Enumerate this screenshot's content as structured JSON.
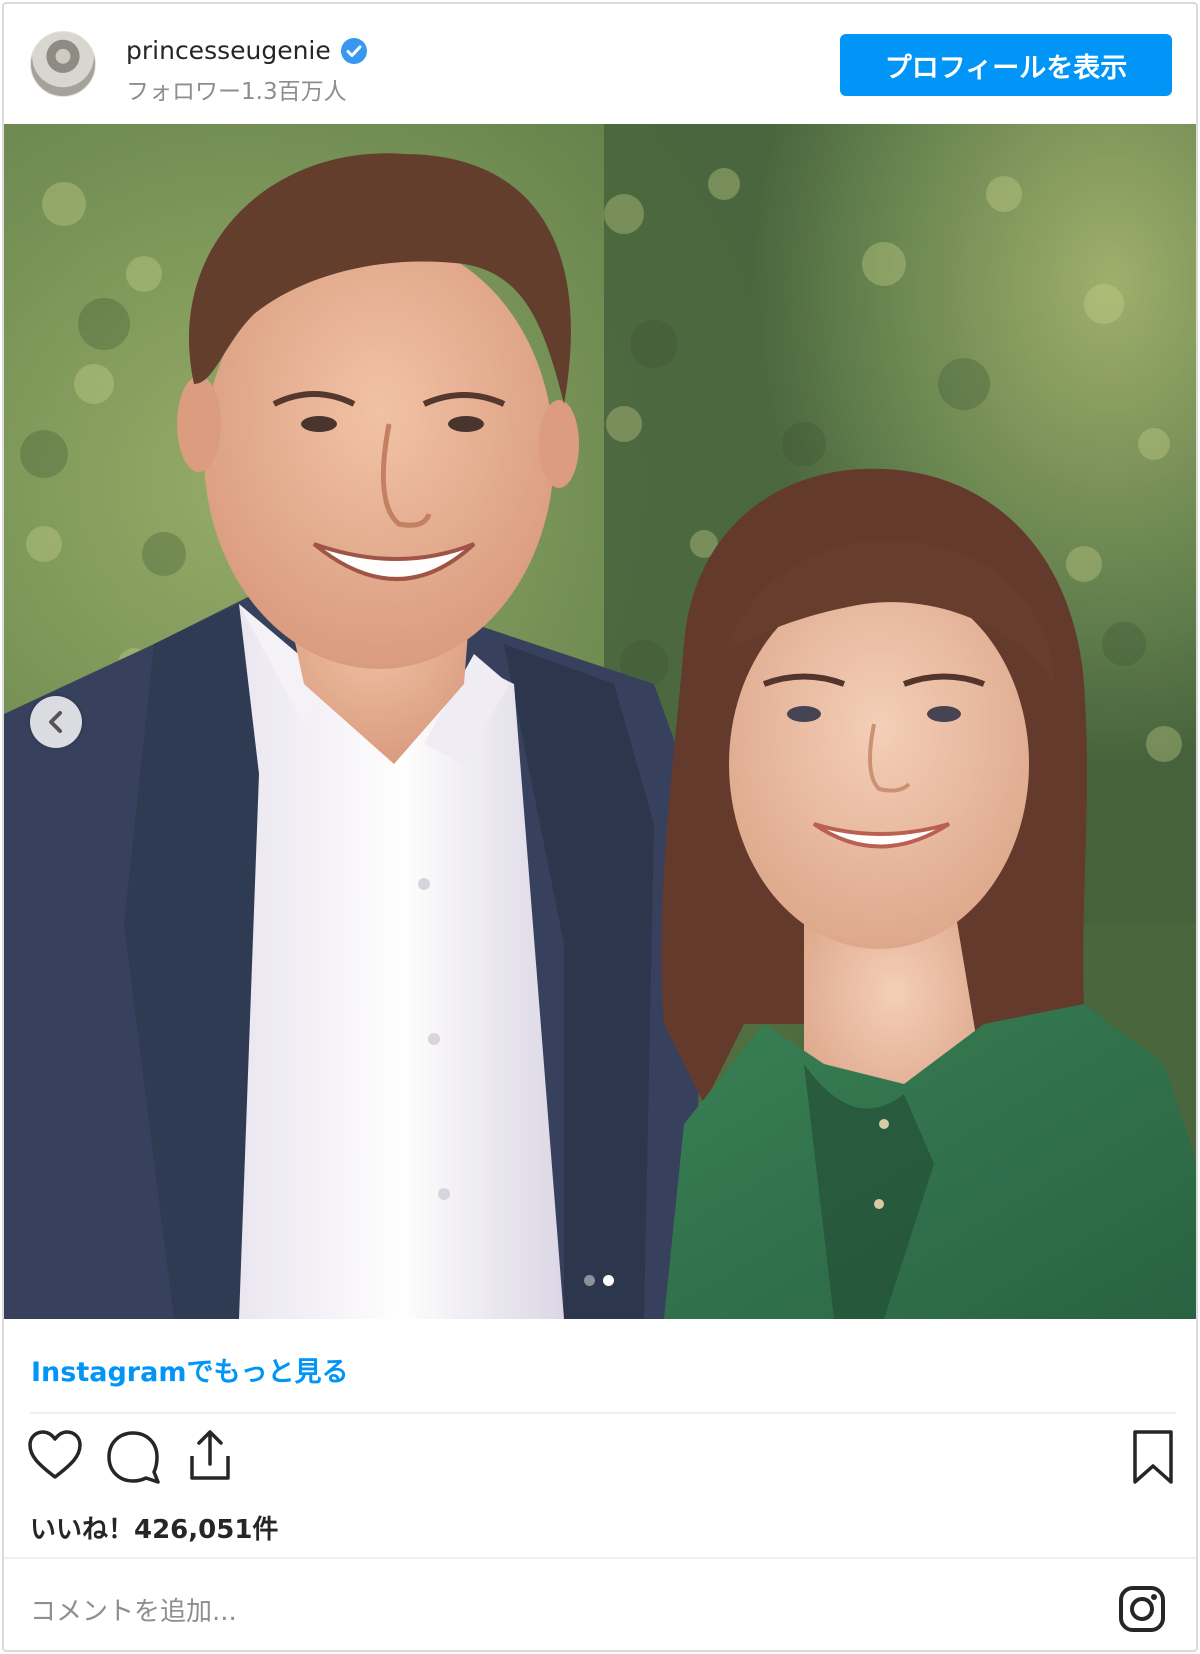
{
  "header": {
    "username": "princesseugenie",
    "verified": true,
    "followers": "フォロワー1.3百万人",
    "profile_button": "プロフィールを表示"
  },
  "carousel": {
    "total_slides": 2,
    "active_slide": 2
  },
  "footer": {
    "more_link": "Instagramでもっと見る",
    "likes": "いいね！426,051件",
    "comment_placeholder": "コメントを追加..."
  },
  "colors": {
    "accent": "#0095f6",
    "verified": "#3897f0",
    "text": "#262626",
    "muted": "#8e8e8e"
  },
  "icons": [
    "verified-badge-icon",
    "chevron-left-icon",
    "heart-icon",
    "comment-icon",
    "share-icon",
    "bookmark-icon",
    "instagram-logo-icon"
  ]
}
